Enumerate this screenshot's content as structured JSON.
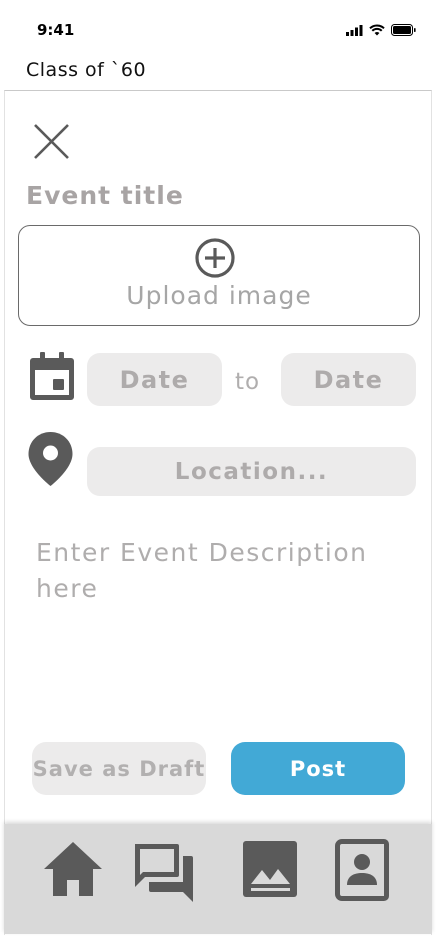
{
  "status_bar": {
    "time": "9:41"
  },
  "header": {
    "title": "Class of `60"
  },
  "form": {
    "event_title_placeholder": "Event title",
    "upload_label": "Upload image",
    "date_start": "Date",
    "date_separator": "to",
    "date_end": "Date",
    "location": "Location...",
    "description_placeholder": "Enter Event Description here"
  },
  "actions": {
    "draft_label": "Save as Draft",
    "post_label": "Post"
  },
  "colors": {
    "accent": "#42a9d6",
    "pill": "#ecebeb",
    "icon": "#5a5a5a",
    "tab_bar": "#d9d9d9"
  },
  "tabs": [
    {
      "icon": "home-icon"
    },
    {
      "icon": "chat-icon"
    },
    {
      "icon": "gallery-icon"
    },
    {
      "icon": "contacts-icon"
    }
  ]
}
